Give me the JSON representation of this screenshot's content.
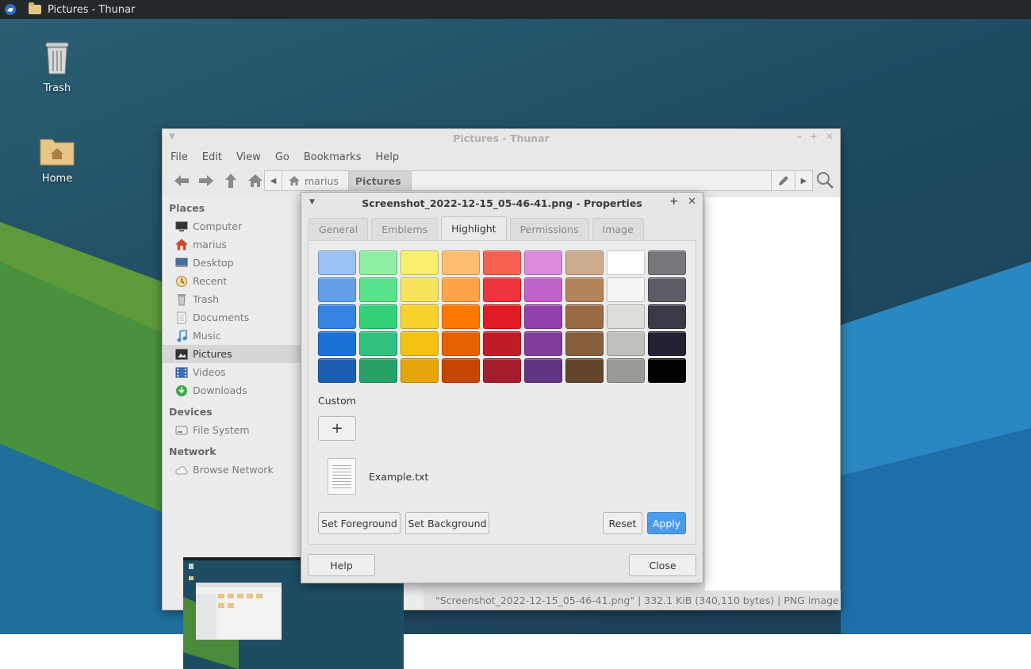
{
  "panel": {
    "task_title": "Pictures - Thunar"
  },
  "desktop": {
    "icons": [
      {
        "label": "Trash"
      },
      {
        "label": "Home"
      }
    ]
  },
  "thunar": {
    "title": "Pictures - Thunar",
    "menu": [
      "File",
      "Edit",
      "View",
      "Go",
      "Bookmarks",
      "Help"
    ],
    "path": [
      "marius",
      "Pictures"
    ],
    "sidebar": {
      "places_header": "Places",
      "places": [
        "Computer",
        "marius",
        "Desktop",
        "Recent",
        "Trash",
        "Documents",
        "Music",
        "Pictures",
        "Videos",
        "Downloads"
      ],
      "devices_header": "Devices",
      "devices": [
        "File System"
      ],
      "network_header": "Network",
      "network": [
        "Browse Network"
      ]
    },
    "status": "\"Screenshot_2022-12-15_05-46-41.png\"  |  332.1 KiB (340,110 bytes)  |  PNG image"
  },
  "dialog": {
    "title": "Screenshot_2022-12-15_05-46-41.png - Properties",
    "tabs": [
      "General",
      "Emblems",
      "Highlight",
      "Permissions",
      "Image"
    ],
    "active_tab": "Highlight",
    "swatch_colors": [
      [
        "#99c1f1",
        "#8ff0a4",
        "#f9f06b",
        "#ffbe6f",
        "#f66151",
        "#dc8add",
        "#cdab8f",
        "#ffffff",
        "#77767b"
      ],
      [
        "#62a0ea",
        "#57e389",
        "#f8e45c",
        "#ffa348",
        "#ed333b",
        "#c061cb",
        "#b5835a",
        "#f6f5f4",
        "#5e5c64"
      ],
      [
        "#3584e4",
        "#33d17a",
        "#f6d32d",
        "#ff7800",
        "#e01b24",
        "#9141ac",
        "#986a44",
        "#deddda",
        "#3d3846"
      ],
      [
        "#1c71d8",
        "#2ec27e",
        "#f5c211",
        "#e66100",
        "#c01c28",
        "#813d9c",
        "#865e3c",
        "#c0bfbc",
        "#241f31"
      ],
      [
        "#1a5fb4",
        "#26a269",
        "#e5a50a",
        "#c64600",
        "#a51d2d",
        "#613583",
        "#63452c",
        "#9a9996",
        "#000000"
      ]
    ],
    "custom_label": "Custom",
    "add_label": "+",
    "example_name": "Example.txt",
    "buttons": {
      "set_foreground": "Set Foreground",
      "set_background": "Set Background",
      "reset": "Reset",
      "apply": "Apply",
      "help": "Help",
      "close": "Close"
    }
  }
}
